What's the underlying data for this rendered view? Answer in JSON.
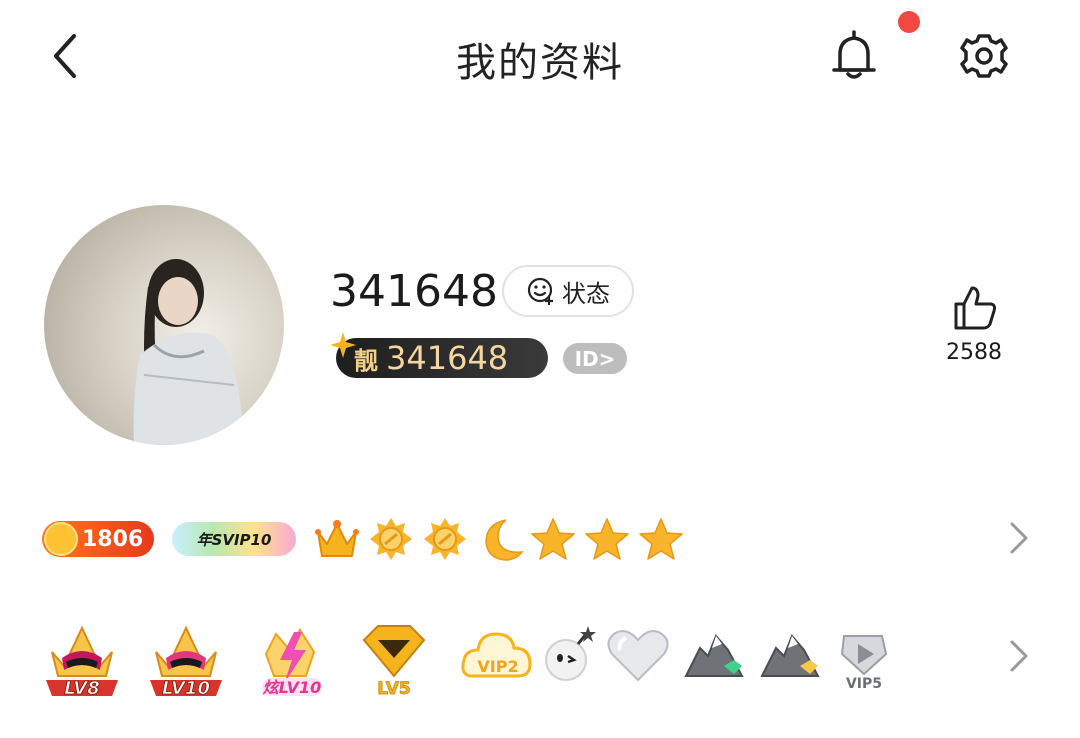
{
  "header": {
    "title": "我的资料"
  },
  "profile": {
    "username": "341648",
    "status_label": "状态",
    "id_prefix": "靓",
    "id_number": "341648",
    "id_tag": "ID>",
    "like_count": "2588"
  },
  "badges_row1": {
    "coins": "1806",
    "svip": "年SVIP10",
    "level_icons": [
      "crown-icon",
      "sun-icon",
      "sun-icon",
      "moon-icon",
      "star-icon",
      "star-icon",
      "star-icon"
    ]
  },
  "badges_row2": {
    "labels": [
      "LV8",
      "LV10",
      "炫LV10",
      "LV5",
      "VIP2",
      "",
      "",
      "",
      "",
      "VIP5"
    ]
  },
  "colors": {
    "notification_dot": "#f2483f",
    "coin": "#ffc233",
    "gold": "#f5b31c"
  }
}
